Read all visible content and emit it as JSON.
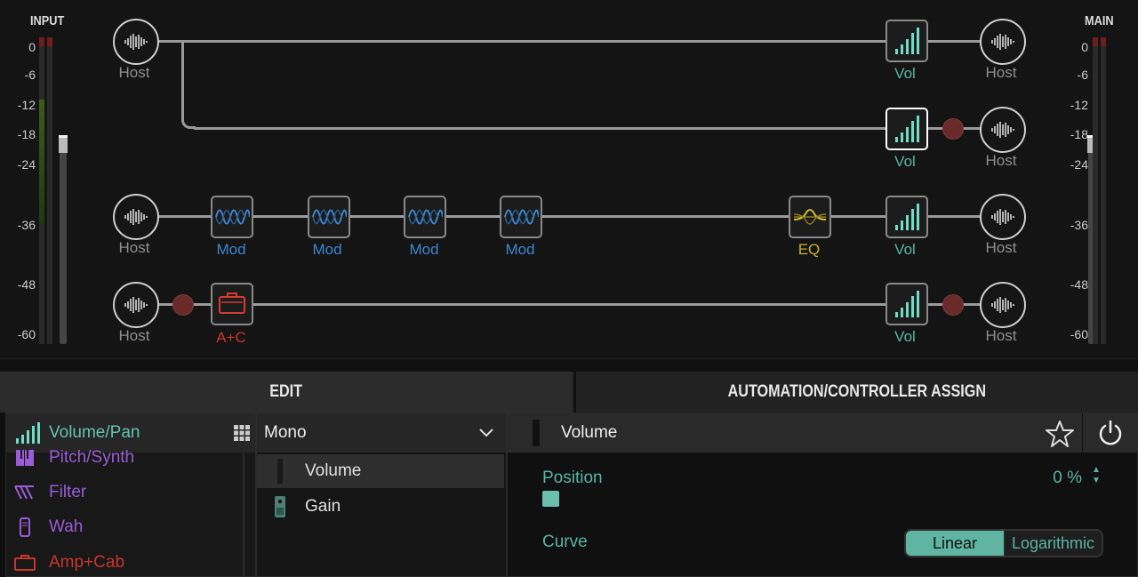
{
  "input_meter": {
    "title": "INPUT",
    "scale": [
      "0",
      "-6",
      "-12",
      "-18",
      "-24",
      "-36",
      "-48",
      "-60"
    ]
  },
  "main_meter": {
    "title": "MAIN",
    "scale": [
      "0",
      "-6",
      "-12",
      "-18",
      "-24",
      "-36",
      "-48",
      "-60"
    ]
  },
  "routing": {
    "row1": {
      "in_label": "Host",
      "vol_label": "Vol",
      "out_label": "Host"
    },
    "row2": {
      "vol_label": "Vol",
      "out_label": "Host"
    },
    "row3": {
      "in_label": "Host",
      "mod1": "Mod",
      "mod2": "Mod",
      "mod3": "Mod",
      "mod4": "Mod",
      "eq": "EQ",
      "vol_label": "Vol",
      "out_label": "Host"
    },
    "row4": {
      "in_label": "Host",
      "amp": "A+C",
      "vol_label": "Vol",
      "out_label": "Host"
    }
  },
  "tabs": {
    "edit": "EDIT",
    "automation": "AUTOMATION/CONTROLLER ASSIGN"
  },
  "categories": {
    "selected": "Volume/Pan",
    "items": [
      "Pitch/Synth",
      "Filter",
      "Wah",
      "Amp+Cab"
    ]
  },
  "models": {
    "selector": "Mono",
    "items": [
      "Volume",
      "Gain"
    ]
  },
  "params": {
    "title": "Volume",
    "position_label": "Position",
    "position_value": "0 %",
    "position_level": 0,
    "curve_label": "Curve",
    "curve_options": [
      "Linear",
      "Logarithmic"
    ],
    "curve_selected": "Linear"
  },
  "colors": {
    "teal": "#58b5a3",
    "blue": "#3d86cf",
    "yellow": "#c9b12c",
    "red": "#c9352d",
    "purple": "#9b5bd6"
  }
}
